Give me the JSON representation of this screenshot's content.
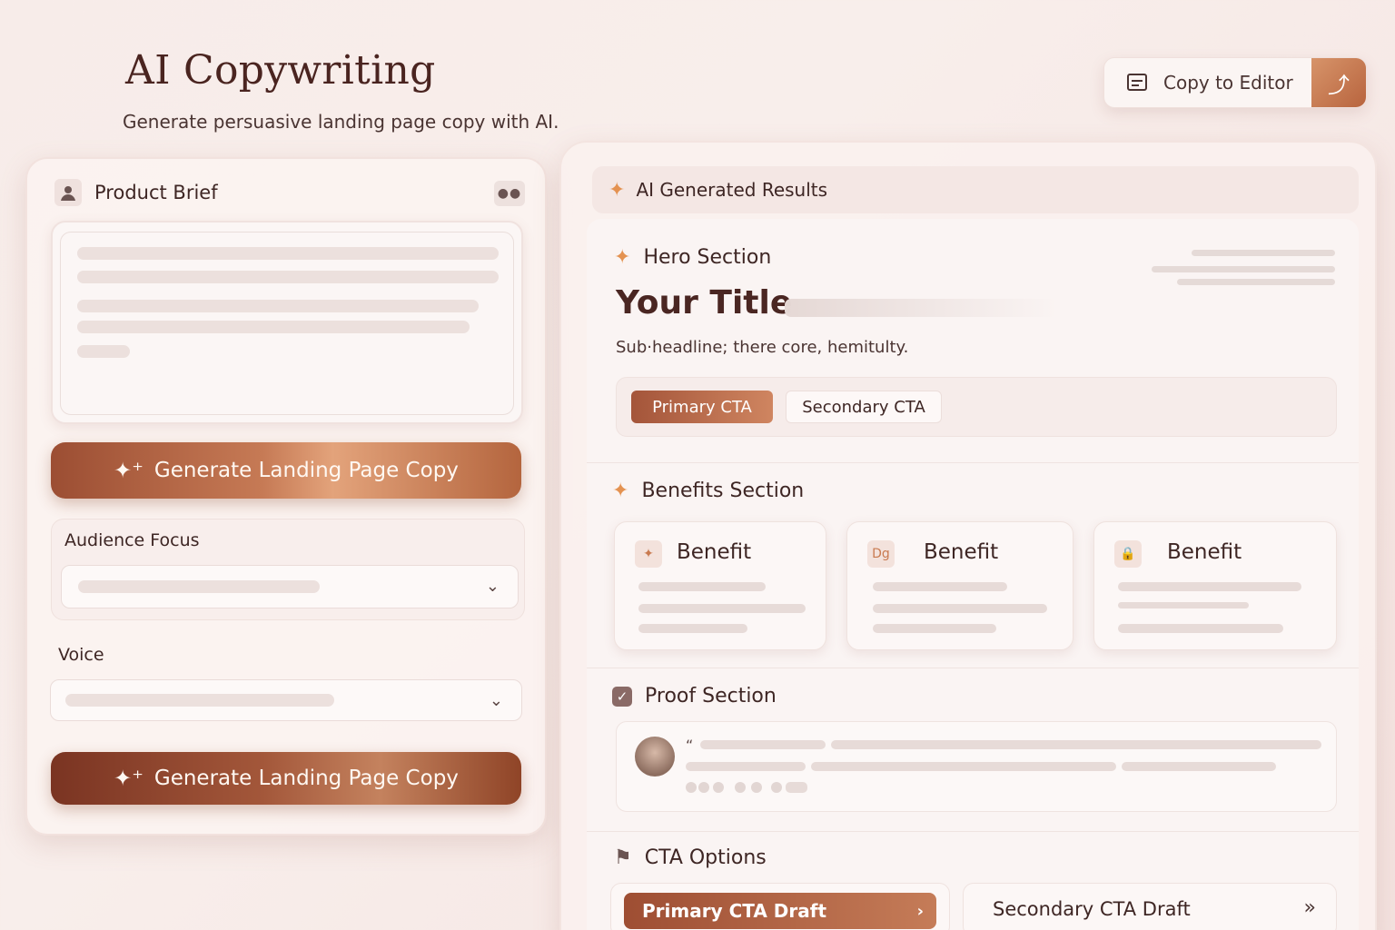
{
  "header": {
    "title": "AI Copywriting",
    "subtitle": "Generate persuasive landing page copy with AI.",
    "copy_button": "Copy to Editor"
  },
  "left_panel": {
    "title": "Product Brief",
    "generate_label": "Generate Landing Page Copy",
    "audience_label": "Audience Focus",
    "voice_label": "Voice",
    "generate_label_2": "Generate Landing Page Copy"
  },
  "results": {
    "title": "AI Generated Results",
    "hero": {
      "section_title": "Hero Section",
      "headline": "Your Title",
      "subheadline": "Sub·headline; there core, hemitulty.",
      "primary_cta": "Primary CTA",
      "secondary_cta": "Secondary CTA"
    },
    "benefits": {
      "section_title": "Benefits Section",
      "cards": [
        {
          "title": "Benefit",
          "icon": "✦"
        },
        {
          "title": "Benefit",
          "icon": "Dg"
        },
        {
          "title": "Benefit",
          "icon": "🔒"
        }
      ]
    },
    "proof": {
      "section_title": "Proof Section",
      "quote_mark": "“"
    },
    "cta_options": {
      "section_title": "CTA Options",
      "primary": "Primary CTA Draft",
      "secondary": "Secondary CTA Draft"
    }
  },
  "colors": {
    "accent": "#c67a55",
    "accent_dark": "#9c4e33",
    "spark": "#e49251"
  }
}
